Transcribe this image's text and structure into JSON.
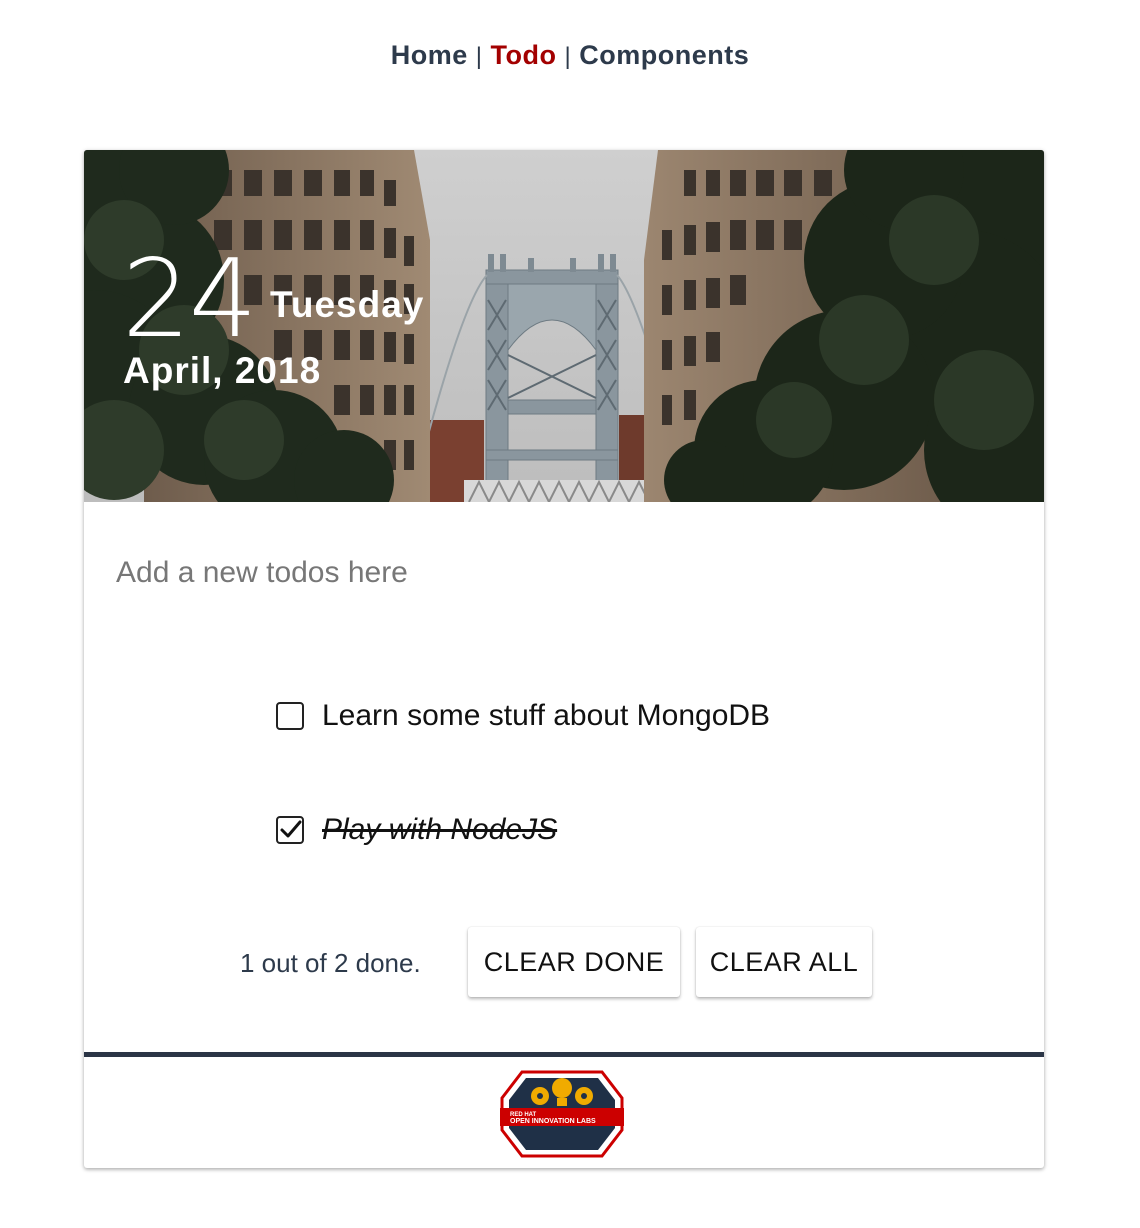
{
  "nav": {
    "items": [
      {
        "label": "Home",
        "active": false
      },
      {
        "label": "Todo",
        "active": true
      },
      {
        "label": "Components",
        "active": false
      }
    ],
    "separator": "|",
    "active_color": "#a30000",
    "text_color": "#2d3a4b"
  },
  "header": {
    "day": "24",
    "weekday": "Tuesday",
    "month_year": "April, 2018"
  },
  "new_todo": {
    "placeholder": "Add a new todos here",
    "value": ""
  },
  "todos": [
    {
      "title": "Learn some stuff about MongoDB",
      "completed": false
    },
    {
      "title": "Play with NodeJS",
      "completed": true
    }
  ],
  "summary": "1 out of 2 done.",
  "buttons": {
    "clear_done": "CLEAR DONE",
    "clear_all": "CLEAR ALL"
  },
  "footer": {
    "logo_line1": "RED HAT",
    "logo_line2": "OPEN INNOVATION LABS",
    "bar_color": "#2b3546",
    "logo_red": "#cc0000",
    "logo_gear": "#f0ab00"
  }
}
